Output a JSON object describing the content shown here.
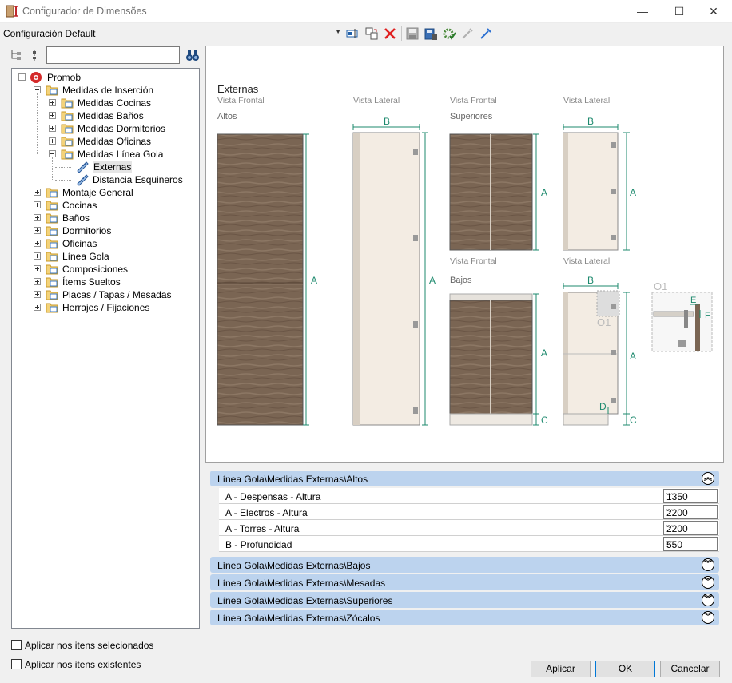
{
  "window": {
    "title": "Configurador de Dimensões",
    "minimize": "—",
    "maximize": "☐",
    "close": "✕"
  },
  "toolbar": {
    "config_value": "Configuración Default",
    "icons": [
      "rename-icon",
      "copy-config-icon",
      "delete-icon",
      "save-icon",
      "calculator-icon",
      "settings-icon",
      "move-down-icon",
      "move-up-icon"
    ]
  },
  "search": {
    "value": ""
  },
  "tree": {
    "root": "Promob",
    "items": [
      {
        "label": "Medidas de Inserción",
        "level": 1
      },
      {
        "label": "Medidas Cocinas",
        "level": 2
      },
      {
        "label": "Medidas Baños",
        "level": 2
      },
      {
        "label": "Medidas Dormitorios",
        "level": 2
      },
      {
        "label": "Medidas Oficinas",
        "level": 2
      },
      {
        "label": "Medidas Línea Gola",
        "level": 2
      },
      {
        "label": "Externas",
        "level": 3
      },
      {
        "label": "Distancia Esquineros",
        "level": 3
      },
      {
        "label": "Montaje General",
        "level": 1
      },
      {
        "label": "Cocinas",
        "level": 1
      },
      {
        "label": "Baños",
        "level": 1
      },
      {
        "label": "Dormitorios",
        "level": 1
      },
      {
        "label": "Oficinas",
        "level": 1
      },
      {
        "label": "Línea Gola",
        "level": 1
      },
      {
        "label": "Composiciones",
        "level": 1
      },
      {
        "label": "Ítems Sueltos",
        "level": 1
      },
      {
        "label": "Placas / Tapas / Mesadas",
        "level": 1
      },
      {
        "label": "Herrajes / Fijaciones",
        "level": 1
      }
    ]
  },
  "preview": {
    "heading": "Externas",
    "views": [
      "Vista Frontal",
      "Vista Lateral",
      "Vista Frontal",
      "Vista Lateral",
      "Vista Frontal",
      "Vista Lateral"
    ],
    "groups": [
      "Altos",
      "Superiores",
      "Bajos"
    ],
    "dims": {
      "A": "A",
      "B": "B",
      "C": "C",
      "D": "D",
      "E": "E",
      "F": "F",
      "O1": "O1"
    }
  },
  "properties": {
    "sections": [
      {
        "title": "Línea Gola\\Medidas Externas\\Altos",
        "expanded": true
      },
      {
        "title": "Línea Gola\\Medidas Externas\\Bajos",
        "expanded": false
      },
      {
        "title": "Línea Gola\\Medidas Externas\\Mesadas",
        "expanded": false
      },
      {
        "title": "Línea Gola\\Medidas Externas\\Superiores",
        "expanded": false
      },
      {
        "title": "Línea Gola\\Medidas Externas\\Zócalos",
        "expanded": false
      }
    ],
    "rows": [
      {
        "name": "A - Despensas - Altura",
        "value": "1350"
      },
      {
        "name": "A - Electros - Altura",
        "value": "2200"
      },
      {
        "name": "A - Torres - Altura",
        "value": "2200"
      },
      {
        "name": "B - Profundidad",
        "value": "550"
      }
    ]
  },
  "options": {
    "apply_selected": "Aplicar nos itens selecionados",
    "apply_existing": "Aplicar nos itens existentes"
  },
  "buttons": {
    "apply": "Aplicar",
    "ok": "OK",
    "cancel": "Cancelar"
  },
  "colors": {
    "accent_teal": "#1e8a6e",
    "wood": "#7a6553",
    "section_blue": "#bcd3ee"
  }
}
